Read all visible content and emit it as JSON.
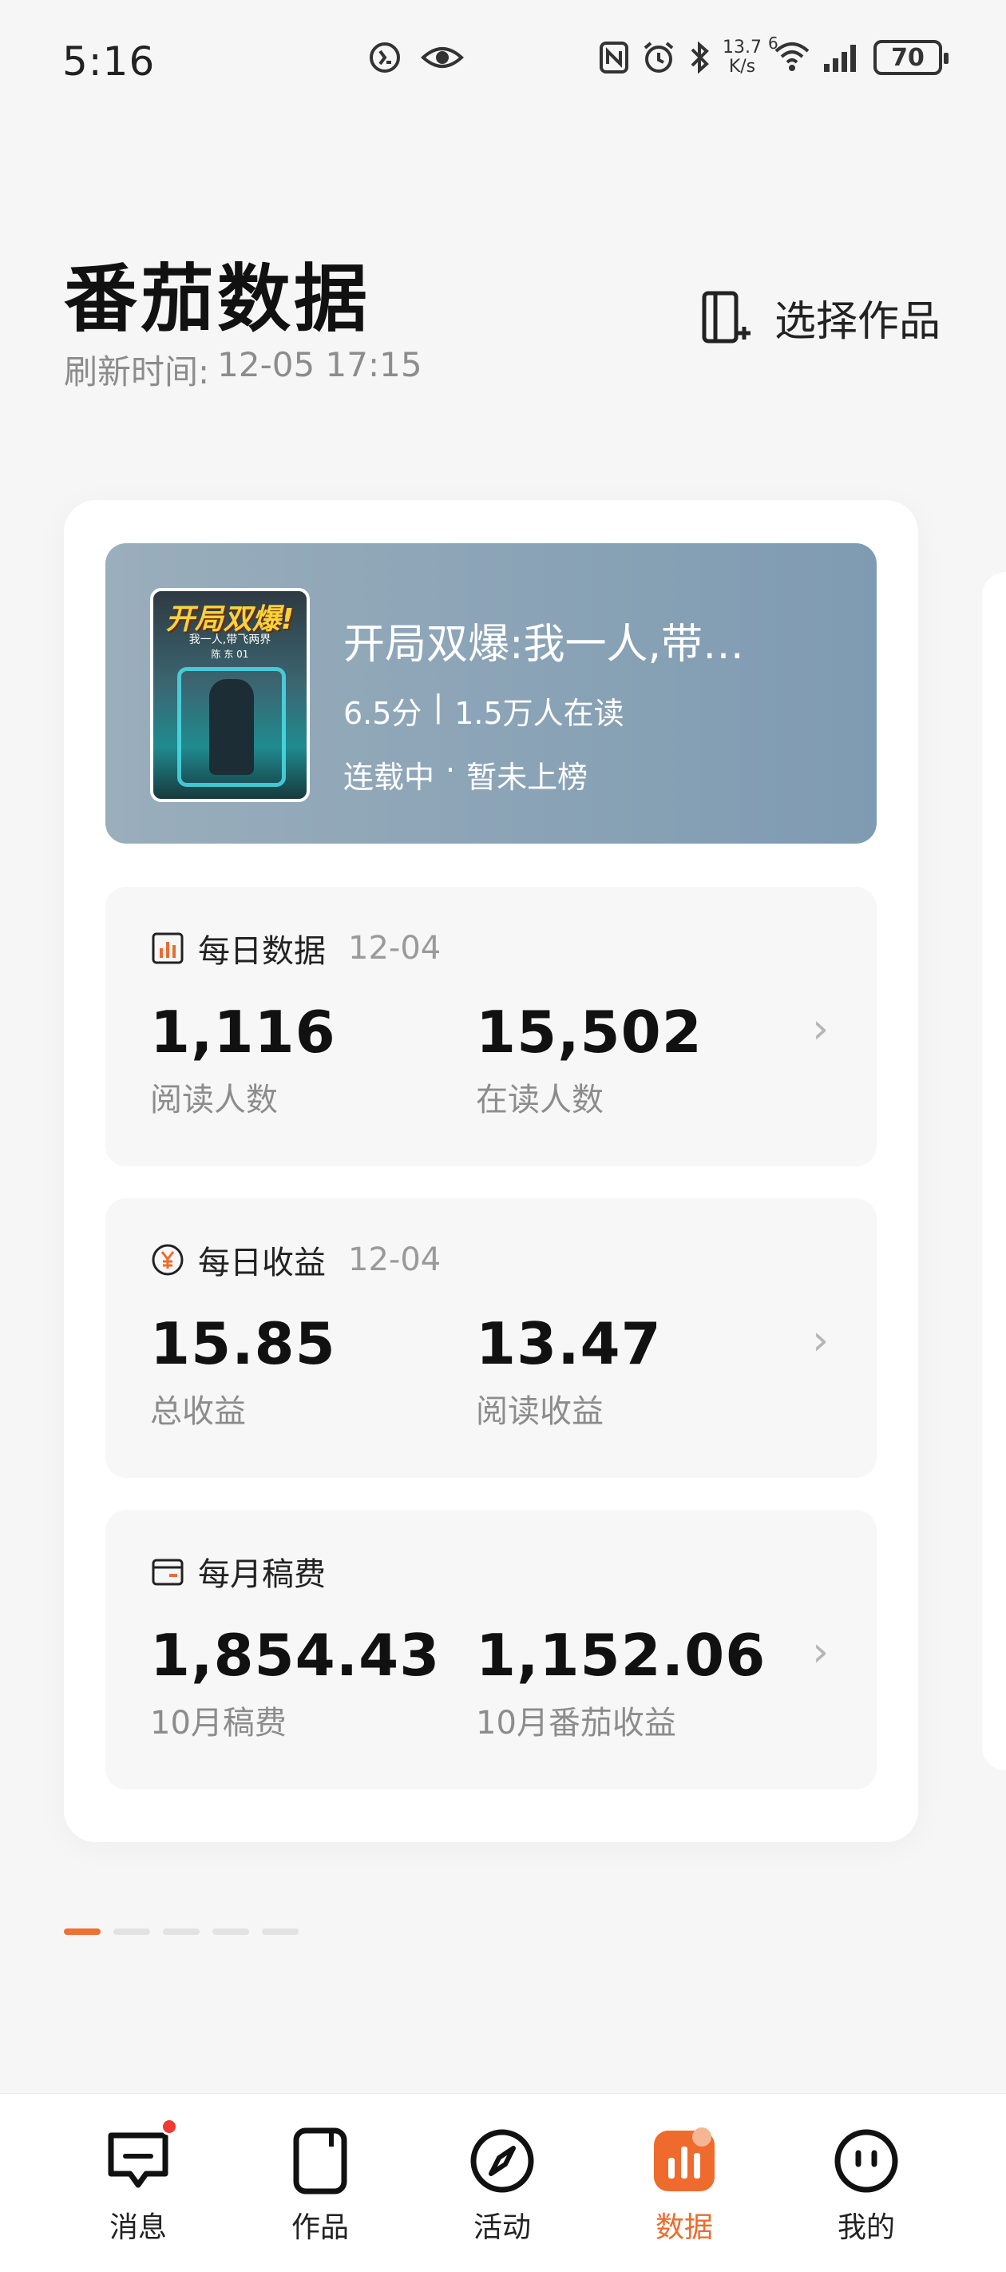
{
  "status_bar": {
    "time": "5:16",
    "net_speed_value": "13.7",
    "net_speed_unit": "K/s",
    "signal_label": "6",
    "battery": "70"
  },
  "header": {
    "title": "番茄数据",
    "refresh_label": "刷新时间:",
    "refresh_time": "12-05 17:15",
    "select_work_label": "选择作品"
  },
  "book": {
    "cover_title": "开局双爆!",
    "cover_sub": "我一人,带飞两界",
    "cover_author": "陈 东 01",
    "name": "开局双爆:我一人,带…",
    "score": "6.5分",
    "separator": "|",
    "readers": "1.5万人在读",
    "status": "连载中",
    "dot": "·",
    "ranking": "暂未上榜"
  },
  "daily_data": {
    "title": "每日数据",
    "date": "12-04",
    "value1": "1,116",
    "label1": "阅读人数",
    "value2": "15,502",
    "label2": "在读人数"
  },
  "daily_income": {
    "title": "每日收益",
    "date": "12-04",
    "value1": "15.85",
    "label1": "总收益",
    "value2": "13.47",
    "label2": "阅读收益"
  },
  "monthly_fee": {
    "title": "每月稿费",
    "value1": "1,854.43",
    "label1": "10月稿费",
    "value2": "1,152.06",
    "label2": "10月番茄收益"
  },
  "pager": {
    "total": 5,
    "active_index": 0
  },
  "nav": {
    "items": [
      {
        "label": "消息"
      },
      {
        "label": "作品"
      },
      {
        "label": "活动"
      },
      {
        "label": "数据"
      },
      {
        "label": "我的"
      }
    ],
    "active_index": 3
  },
  "colors": {
    "accent": "#ee6b2d",
    "banner": "#8aa3b6",
    "badge": "#ee3a32"
  }
}
